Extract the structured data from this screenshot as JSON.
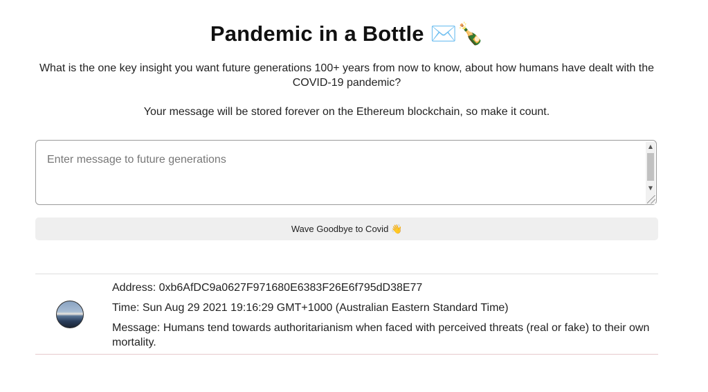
{
  "header": {
    "title": "Pandemic in a Bottle",
    "title_emoji": "✉️🍾"
  },
  "intro": {
    "question": "What is the one key insight you want future generations 100+ years from now to know, about how humans have dealt with the COVID-19 pandemic?",
    "note": "Your message will be stored forever on the Ethereum blockchain, so make it count."
  },
  "form": {
    "message_value": "",
    "message_placeholder": "Enter message to future generations",
    "submit_label": "Wave Goodbye to Covid",
    "submit_emoji": "👋"
  },
  "messages": [
    {
      "address_label": "Address: 0xb6AfDC9a0627F971680E6383F26E6f795dD38E77",
      "time_label": "Time: Sun Aug 29 2021 19:16:29 GMT+1000 (Australian Eastern Standard Time)",
      "message_label": "Message: Humans tend towards authoritarianism when faced with perceived threats (real or fake) to their own mortality.",
      "avatar": "landscape-avatar"
    }
  ],
  "colors": {
    "button_bg": "#efefef",
    "divider_top": "#dddddd",
    "divider_bottom": "#e6c9cc"
  }
}
